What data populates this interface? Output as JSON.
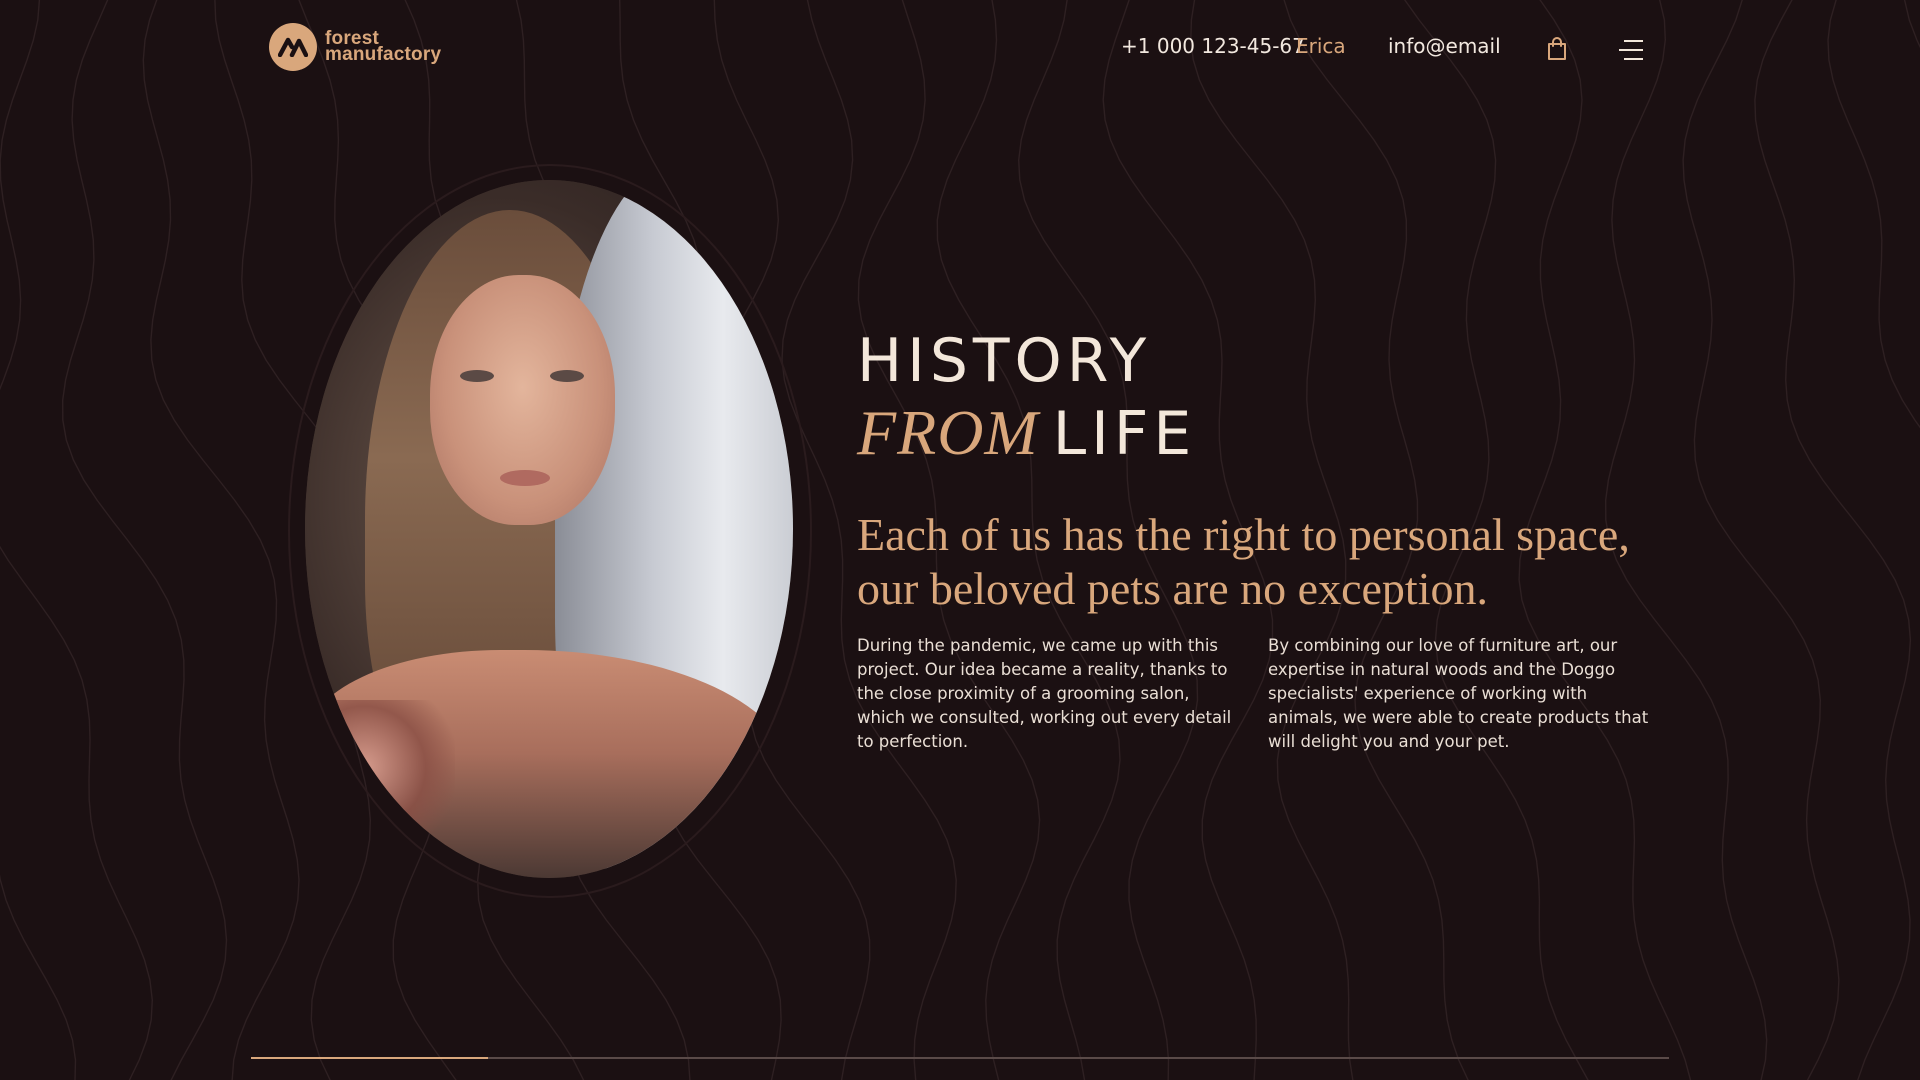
{
  "brand": {
    "line1": "forest",
    "line2": "manufactory",
    "logo_icon": "brand-monogram-icon"
  },
  "header": {
    "phone": "+1 000 123-45-67",
    "user": "Erica",
    "email": "info@email",
    "icons": [
      "shopping-bag-icon",
      "menu-icon"
    ]
  },
  "hero": {
    "title_line1": "HISTORY",
    "title_accent": "FROM",
    "title_rest": "LIFE",
    "tagline_line1": "Each of us has the right to personal space,",
    "tagline_line2": "our beloved pets are no exception.",
    "paragraph1": "During the pandemic, we came up with this project. Our idea became a reality, thanks to the close proximity of a grooming salon, which we consulted, working out every detail to perfection.",
    "paragraph2": "By combining our love of furniture art, our expertise in natural woods and the Doggo specialists' experience of working with animals, we were able to create products that will delight you and your pet."
  },
  "slider": {
    "progress_fraction": 0.167
  },
  "colors": {
    "background": "#1b1012",
    "accent": "#d9a77c",
    "text": "#f3e7da"
  }
}
